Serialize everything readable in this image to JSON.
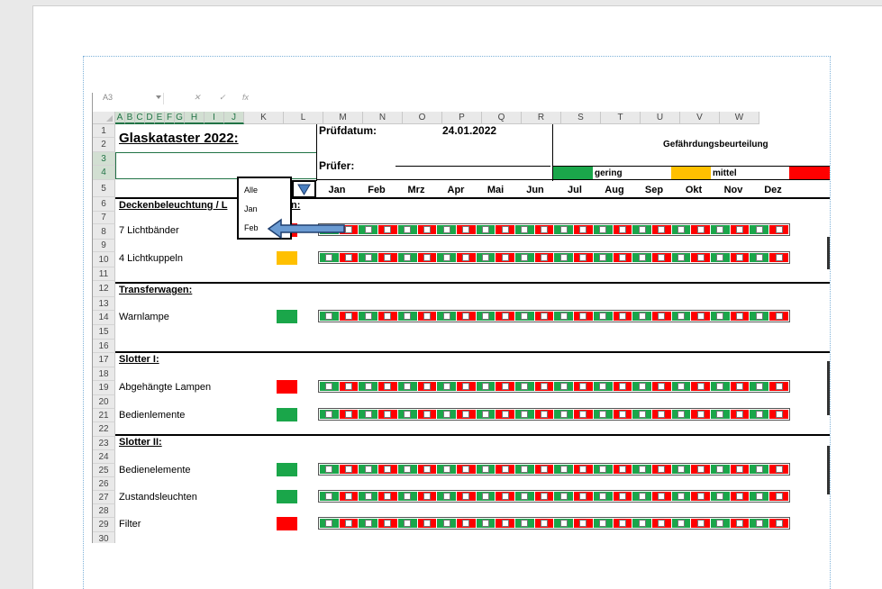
{
  "formula_bar": {
    "cell_ref": "A3",
    "fx": "fx"
  },
  "columns": [
    "A",
    "B",
    "C",
    "D",
    "E",
    "F",
    "G",
    "H",
    "I",
    "J",
    "K",
    "L",
    "M",
    "N",
    "O",
    "P",
    "Q",
    "R",
    "S",
    "T",
    "U",
    "V",
    "W"
  ],
  "selected_columns": [
    "A",
    "B",
    "C",
    "D",
    "E",
    "F",
    "G",
    "H",
    "I",
    "J"
  ],
  "rows": [
    "1",
    "2",
    "3",
    "4",
    "5",
    "6",
    "7",
    "8",
    "9",
    "10",
    "11",
    "12",
    "13",
    "14",
    "15",
    "16",
    "17",
    "18",
    "19",
    "20",
    "21",
    "22",
    "23",
    "24",
    "25",
    "26",
    "27",
    "28",
    "29",
    "30"
  ],
  "header": {
    "title": "Glaskataster 2022:",
    "pruefdatum_label": "Prüfdatum:",
    "pruefdatum_value": "24.01.2022",
    "pruefer_label": "Prüfer:",
    "risk_title": "Gefährdungsbeurteilung",
    "legend": [
      {
        "label": "gering",
        "color": "#1aa64a"
      },
      {
        "label": "mittel",
        "color": "#ffc000"
      },
      {
        "label": "",
        "color": "#ff0000"
      }
    ]
  },
  "months": [
    "Jan",
    "Feb",
    "Mrz",
    "Apr",
    "Mai",
    "Jun",
    "Jul",
    "Aug",
    "Sep",
    "Okt",
    "Nov",
    "Dez"
  ],
  "dropdown": {
    "options": [
      "Alle",
      "Jan",
      "Feb"
    ]
  },
  "sections": [
    {
      "row": "6",
      "title": "Deckenbeleuchtung / L",
      "title_suffix": "n:"
    },
    {
      "row": "12",
      "title": "Transferwagen:"
    },
    {
      "row": "17",
      "title": "Slotter I:"
    },
    {
      "row": "23",
      "title": "Slotter II:"
    }
  ],
  "items": [
    {
      "row": "8",
      "label": "7 Lichtbänder",
      "color": "#ff0000"
    },
    {
      "row": "10",
      "label": "4 Lichtkuppeln",
      "color": "#ffc000"
    },
    {
      "row": "14",
      "label": "Warnlampe",
      "color": "#1aa64a"
    },
    {
      "row": "19",
      "label": "Abgehängte Lampen",
      "color": "#ff0000"
    },
    {
      "row": "21",
      "label": "Bedienlemente",
      "color": "#1aa64a"
    },
    {
      "row": "25",
      "label": "Bedienelemente",
      "color": "#1aa64a"
    },
    {
      "row": "27",
      "label": "Zustandsleuchten",
      "color": "#1aa64a"
    },
    {
      "row": "29",
      "label": "Filter",
      "color": "#ff0000"
    }
  ],
  "colors": {
    "green": "#1aa64a",
    "red": "#ff0000",
    "amber": "#ffc000",
    "excel_green": "#217346",
    "arrow_blue": "#6b9bd2"
  }
}
